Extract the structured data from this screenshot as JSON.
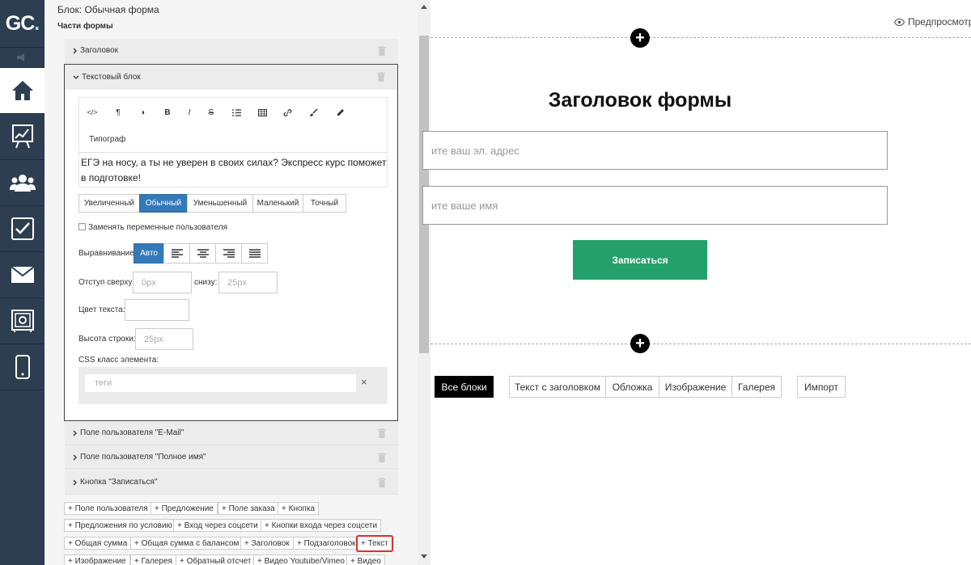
{
  "nav": {
    "logo_main": "GC",
    "logo_dot": ".",
    "items": [
      "home-icon",
      "chart-icon",
      "users-icon",
      "tasks-icon",
      "mail-icon",
      "safe-icon",
      "mobile-icon"
    ]
  },
  "panel": {
    "block_title": "Блок: Обычная форма",
    "parts_title": "Части формы",
    "parts": {
      "heading": "Заголовок",
      "text_block": "Текстовый блок",
      "email_field": "Поле пользователя \"E-Mail\"",
      "name_field": "Поле пользователя \"Полное имя\"",
      "button": "Кнопка \"Записаться\""
    },
    "editor": {
      "toolbar": [
        "</>",
        "¶",
        "◑",
        "B",
        "I",
        "S",
        "list",
        "table",
        "link",
        "brush",
        "pen"
      ],
      "typograph": "Типограф",
      "content": "ЕГЭ на носу, а ты не уверен в своих силах? Экспресс курс поможет в подготовке!"
    },
    "size_options": [
      "Увеличенный",
      "Обычный",
      "Уменьшенный",
      "Маленький",
      "Точный"
    ],
    "size_selected": "Обычный",
    "replace_vars": "Заменять переменные пользователя",
    "align_label": "Выравнивание",
    "align_auto": "Авто",
    "padding_top_label": "Отступ сверху:",
    "padding_top_placeholder": "0px",
    "padding_bottom_label": "снизу:",
    "padding_bottom_placeholder": "25px",
    "text_color_label": "Цвет текста:",
    "line_height_label": "Высота строки:",
    "line_height_placeholder": "25px",
    "css_label": "CSS класс элемента:",
    "css_placeholder": "теги",
    "css_clear": "×",
    "add_buttons": {
      "user_field": "+ Поле пользователя",
      "offer": "+ Предложение",
      "order_field": "+ Поле заказа",
      "button": "+ Кнопка",
      "conditional_offers": "+ Предложения по условию",
      "social_login": "+ Вход через соцсети",
      "social_buttons": "+ Кнопки входа через соцсети",
      "total": "+ Общая сумма",
      "total_balance": "+ Общая сумма с балансом",
      "heading": "+ Заголовок",
      "subheading": "+ Подзаголовок",
      "text": "+ Текст",
      "image": "+ Изображение",
      "gallery": "+ Галерея",
      "countdown": "+ Обратный отсчет",
      "video_youtube": "+ Видео Youtube/Vimeo",
      "video": "+ Видео"
    }
  },
  "canvas": {
    "preview": "Предпросмотр",
    "form_title": "Заголовок формы",
    "email_placeholder": "ите ваш эл. адрес",
    "name_placeholder": "ите ваше имя",
    "submit": "Записаться",
    "add_plus": "+",
    "block_buttons": {
      "all": "Все блоки",
      "text_heading": "Текст с заголовком",
      "cover": "Обложка",
      "image": "Изображение",
      "gallery": "Галерея",
      "import": "Импорт"
    }
  }
}
